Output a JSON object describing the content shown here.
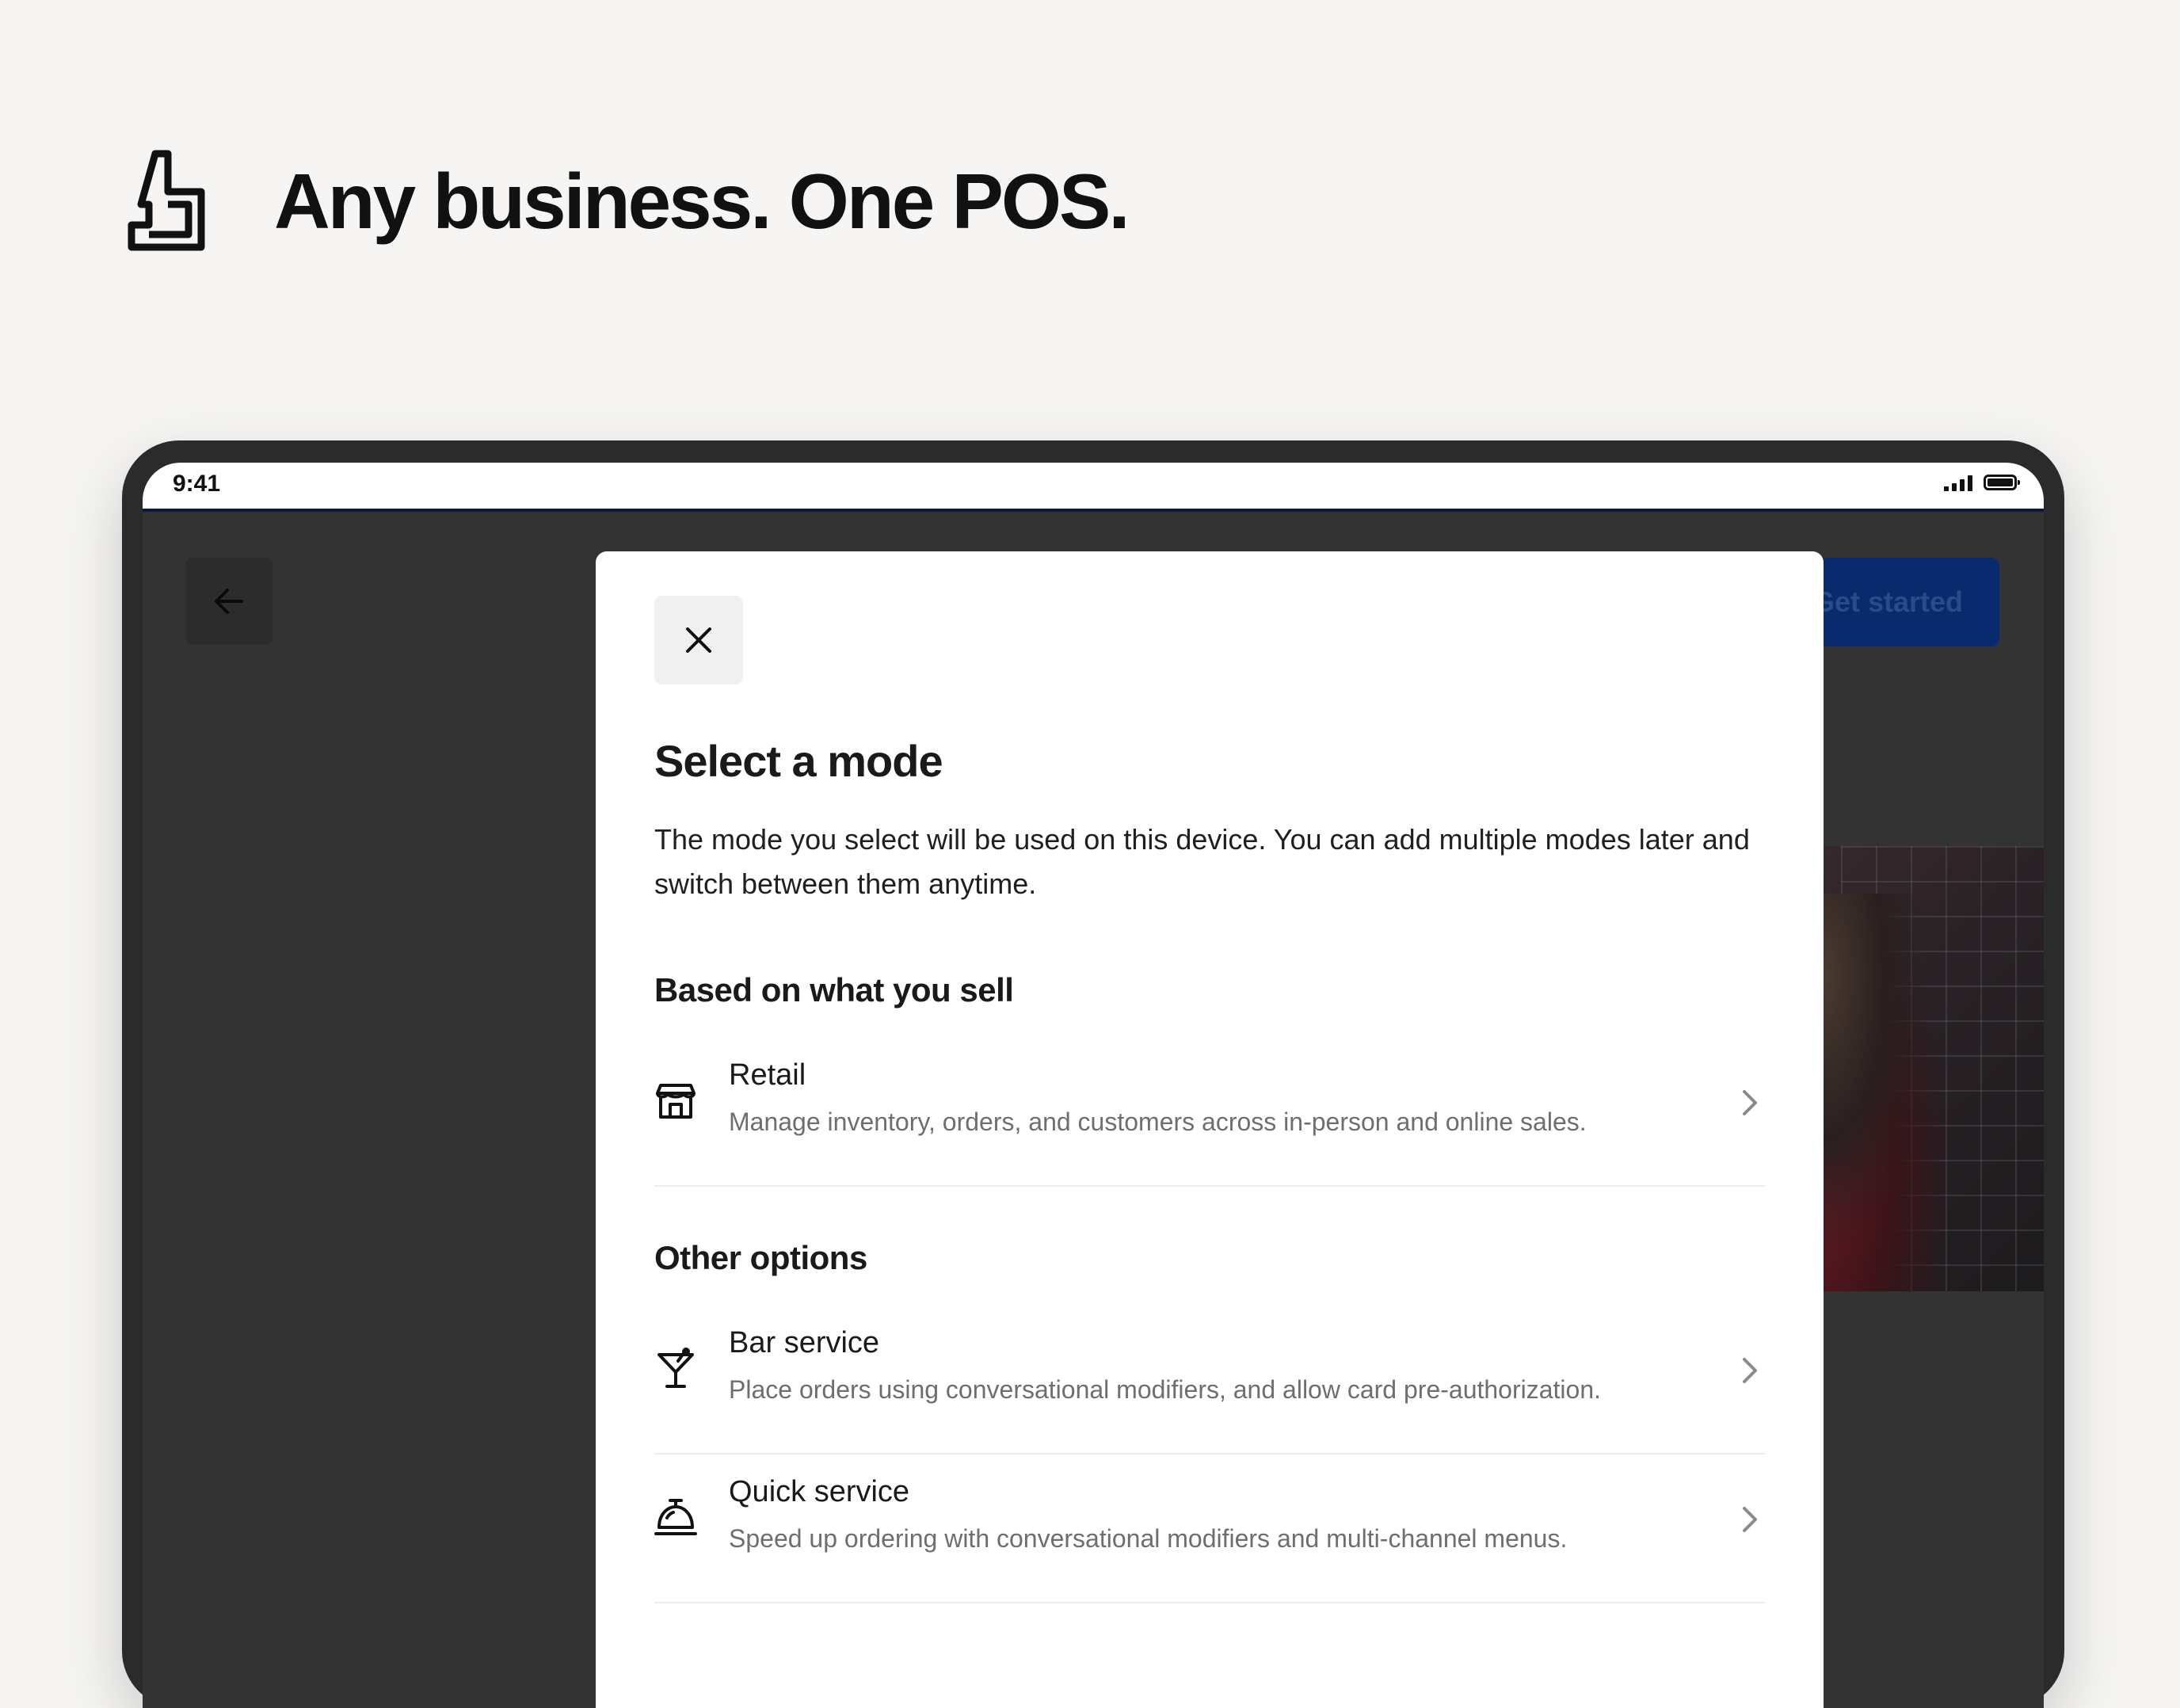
{
  "hero": {
    "title": "Any business. One POS."
  },
  "status_bar": {
    "time": "9:41"
  },
  "header": {
    "get_started_label": "Get started"
  },
  "modal": {
    "title": "Select a mode",
    "description": "The mode you select will be used on this device. You can add multiple modes later and switch between them anytime.",
    "sections": [
      {
        "title": "Based on what you sell",
        "options": [
          {
            "label": "Retail",
            "description": "Manage inventory, orders, and customers across in-person and online sales.",
            "icon": "storefront-icon"
          }
        ]
      },
      {
        "title": "Other options",
        "options": [
          {
            "label": "Bar service",
            "description": "Place orders using conversational modifiers, and allow card pre-authorization.",
            "icon": "cocktail-icon"
          },
          {
            "label": "Quick service",
            "description": "Speed up ordering with conversational modifiers and multi-channel menus.",
            "icon": "service-bell-icon"
          }
        ]
      }
    ]
  },
  "colors": {
    "primary_button": "#0a2a6e",
    "overlay": "#333333",
    "page_bg": "#f6f5f3"
  }
}
